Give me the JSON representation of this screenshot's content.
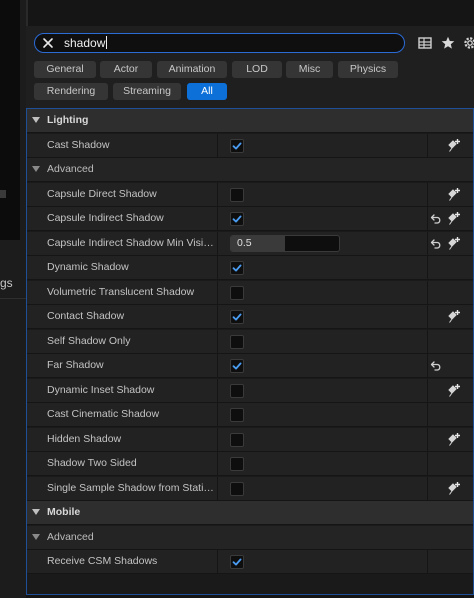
{
  "left_panel": {
    "cut_text": "gs"
  },
  "search": {
    "value": "shadow"
  },
  "toolbar_icons": [
    "table-icon",
    "star-icon",
    "gear-icon"
  ],
  "filters": [
    {
      "label": "General",
      "active": false
    },
    {
      "label": "Actor",
      "active": false
    },
    {
      "label": "Animation",
      "active": false
    },
    {
      "label": "LOD",
      "active": false
    },
    {
      "label": "Misc",
      "active": false
    },
    {
      "label": "Physics",
      "active": false
    },
    {
      "label": "Rendering",
      "active": false
    },
    {
      "label": "Streaming",
      "active": false
    },
    {
      "label": "All",
      "active": true
    }
  ],
  "rows": [
    {
      "type": "category",
      "label": "Lighting"
    },
    {
      "type": "prop",
      "label": "Cast Shadow",
      "control": "checkbox",
      "checked": true,
      "reset": false,
      "add": true
    },
    {
      "type": "subcategory",
      "label": "Advanced"
    },
    {
      "type": "prop",
      "label": "Capsule Direct Shadow",
      "control": "checkbox",
      "checked": false,
      "reset": false,
      "add": true
    },
    {
      "type": "prop",
      "label": "Capsule Indirect Shadow",
      "control": "checkbox",
      "checked": true,
      "reset": true,
      "add": true
    },
    {
      "type": "prop",
      "label": "Capsule Indirect Shadow Min Visibility",
      "control": "number",
      "value": "0.5",
      "fill_fraction": 0.5,
      "reset": true,
      "add": true
    },
    {
      "type": "prop",
      "label": "Dynamic Shadow",
      "control": "checkbox",
      "checked": true,
      "reset": false,
      "add": false
    },
    {
      "type": "prop",
      "label": "Volumetric Translucent Shadow",
      "control": "checkbox",
      "checked": false,
      "reset": false,
      "add": false
    },
    {
      "type": "prop",
      "label": "Contact Shadow",
      "control": "checkbox",
      "checked": true,
      "reset": false,
      "add": true
    },
    {
      "type": "prop",
      "label": "Self Shadow Only",
      "control": "checkbox",
      "checked": false,
      "reset": false,
      "add": false
    },
    {
      "type": "prop",
      "label": "Far Shadow",
      "control": "checkbox",
      "checked": true,
      "reset": true,
      "add": false
    },
    {
      "type": "prop",
      "label": "Dynamic Inset Shadow",
      "control": "checkbox",
      "checked": false,
      "reset": false,
      "add": true
    },
    {
      "type": "prop",
      "label": "Cast Cinematic Shadow",
      "control": "checkbox",
      "checked": false,
      "reset": false,
      "add": false
    },
    {
      "type": "prop",
      "label": "Hidden Shadow",
      "control": "checkbox",
      "checked": false,
      "reset": false,
      "add": true
    },
    {
      "type": "prop",
      "label": "Shadow Two Sided",
      "control": "checkbox",
      "checked": false,
      "reset": false,
      "add": false
    },
    {
      "type": "prop",
      "label": "Single Sample Shadow from Stationary Lights",
      "control": "checkbox",
      "checked": false,
      "reset": false,
      "add": true
    },
    {
      "type": "category",
      "label": "Mobile"
    },
    {
      "type": "subcategory",
      "label": "Advanced"
    },
    {
      "type": "prop",
      "label": "Receive CSM Shadows",
      "control": "checkbox",
      "checked": true,
      "reset": false,
      "add": false
    }
  ],
  "colors": {
    "accent": "#0d70d9",
    "check": "#4a9df2",
    "focus_border": "#2b6bd6"
  }
}
